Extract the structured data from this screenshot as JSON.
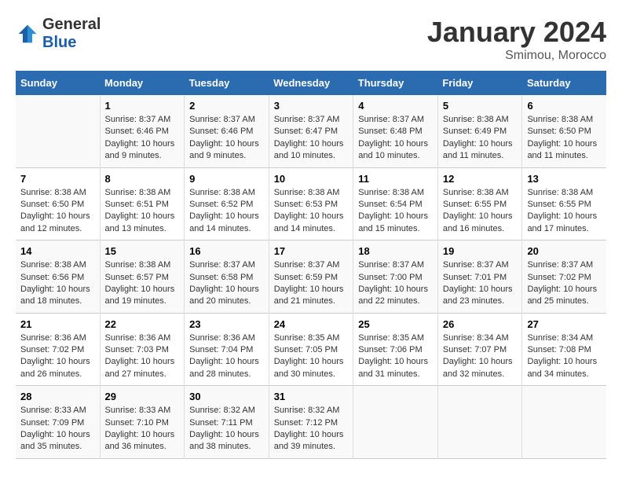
{
  "header": {
    "logo_general": "General",
    "logo_blue": "Blue",
    "month_year": "January 2024",
    "location": "Smimou, Morocco"
  },
  "weekdays": [
    "Sunday",
    "Monday",
    "Tuesday",
    "Wednesday",
    "Thursday",
    "Friday",
    "Saturday"
  ],
  "weeks": [
    [
      {
        "day": "",
        "info": ""
      },
      {
        "day": "1",
        "info": "Sunrise: 8:37 AM\nSunset: 6:46 PM\nDaylight: 10 hours\nand 9 minutes."
      },
      {
        "day": "2",
        "info": "Sunrise: 8:37 AM\nSunset: 6:46 PM\nDaylight: 10 hours\nand 9 minutes."
      },
      {
        "day": "3",
        "info": "Sunrise: 8:37 AM\nSunset: 6:47 PM\nDaylight: 10 hours\nand 10 minutes."
      },
      {
        "day": "4",
        "info": "Sunrise: 8:37 AM\nSunset: 6:48 PM\nDaylight: 10 hours\nand 10 minutes."
      },
      {
        "day": "5",
        "info": "Sunrise: 8:38 AM\nSunset: 6:49 PM\nDaylight: 10 hours\nand 11 minutes."
      },
      {
        "day": "6",
        "info": "Sunrise: 8:38 AM\nSunset: 6:50 PM\nDaylight: 10 hours\nand 11 minutes."
      }
    ],
    [
      {
        "day": "7",
        "info": "Sunrise: 8:38 AM\nSunset: 6:50 PM\nDaylight: 10 hours\nand 12 minutes."
      },
      {
        "day": "8",
        "info": "Sunrise: 8:38 AM\nSunset: 6:51 PM\nDaylight: 10 hours\nand 13 minutes."
      },
      {
        "day": "9",
        "info": "Sunrise: 8:38 AM\nSunset: 6:52 PM\nDaylight: 10 hours\nand 14 minutes."
      },
      {
        "day": "10",
        "info": "Sunrise: 8:38 AM\nSunset: 6:53 PM\nDaylight: 10 hours\nand 14 minutes."
      },
      {
        "day": "11",
        "info": "Sunrise: 8:38 AM\nSunset: 6:54 PM\nDaylight: 10 hours\nand 15 minutes."
      },
      {
        "day": "12",
        "info": "Sunrise: 8:38 AM\nSunset: 6:55 PM\nDaylight: 10 hours\nand 16 minutes."
      },
      {
        "day": "13",
        "info": "Sunrise: 8:38 AM\nSunset: 6:55 PM\nDaylight: 10 hours\nand 17 minutes."
      }
    ],
    [
      {
        "day": "14",
        "info": "Sunrise: 8:38 AM\nSunset: 6:56 PM\nDaylight: 10 hours\nand 18 minutes."
      },
      {
        "day": "15",
        "info": "Sunrise: 8:38 AM\nSunset: 6:57 PM\nDaylight: 10 hours\nand 19 minutes."
      },
      {
        "day": "16",
        "info": "Sunrise: 8:37 AM\nSunset: 6:58 PM\nDaylight: 10 hours\nand 20 minutes."
      },
      {
        "day": "17",
        "info": "Sunrise: 8:37 AM\nSunset: 6:59 PM\nDaylight: 10 hours\nand 21 minutes."
      },
      {
        "day": "18",
        "info": "Sunrise: 8:37 AM\nSunset: 7:00 PM\nDaylight: 10 hours\nand 22 minutes."
      },
      {
        "day": "19",
        "info": "Sunrise: 8:37 AM\nSunset: 7:01 PM\nDaylight: 10 hours\nand 23 minutes."
      },
      {
        "day": "20",
        "info": "Sunrise: 8:37 AM\nSunset: 7:02 PM\nDaylight: 10 hours\nand 25 minutes."
      }
    ],
    [
      {
        "day": "21",
        "info": "Sunrise: 8:36 AM\nSunset: 7:02 PM\nDaylight: 10 hours\nand 26 minutes."
      },
      {
        "day": "22",
        "info": "Sunrise: 8:36 AM\nSunset: 7:03 PM\nDaylight: 10 hours\nand 27 minutes."
      },
      {
        "day": "23",
        "info": "Sunrise: 8:36 AM\nSunset: 7:04 PM\nDaylight: 10 hours\nand 28 minutes."
      },
      {
        "day": "24",
        "info": "Sunrise: 8:35 AM\nSunset: 7:05 PM\nDaylight: 10 hours\nand 30 minutes."
      },
      {
        "day": "25",
        "info": "Sunrise: 8:35 AM\nSunset: 7:06 PM\nDaylight: 10 hours\nand 31 minutes."
      },
      {
        "day": "26",
        "info": "Sunrise: 8:34 AM\nSunset: 7:07 PM\nDaylight: 10 hours\nand 32 minutes."
      },
      {
        "day": "27",
        "info": "Sunrise: 8:34 AM\nSunset: 7:08 PM\nDaylight: 10 hours\nand 34 minutes."
      }
    ],
    [
      {
        "day": "28",
        "info": "Sunrise: 8:33 AM\nSunset: 7:09 PM\nDaylight: 10 hours\nand 35 minutes."
      },
      {
        "day": "29",
        "info": "Sunrise: 8:33 AM\nSunset: 7:10 PM\nDaylight: 10 hours\nand 36 minutes."
      },
      {
        "day": "30",
        "info": "Sunrise: 8:32 AM\nSunset: 7:11 PM\nDaylight: 10 hours\nand 38 minutes."
      },
      {
        "day": "31",
        "info": "Sunrise: 8:32 AM\nSunset: 7:12 PM\nDaylight: 10 hours\nand 39 minutes."
      },
      {
        "day": "",
        "info": ""
      },
      {
        "day": "",
        "info": ""
      },
      {
        "day": "",
        "info": ""
      }
    ]
  ]
}
